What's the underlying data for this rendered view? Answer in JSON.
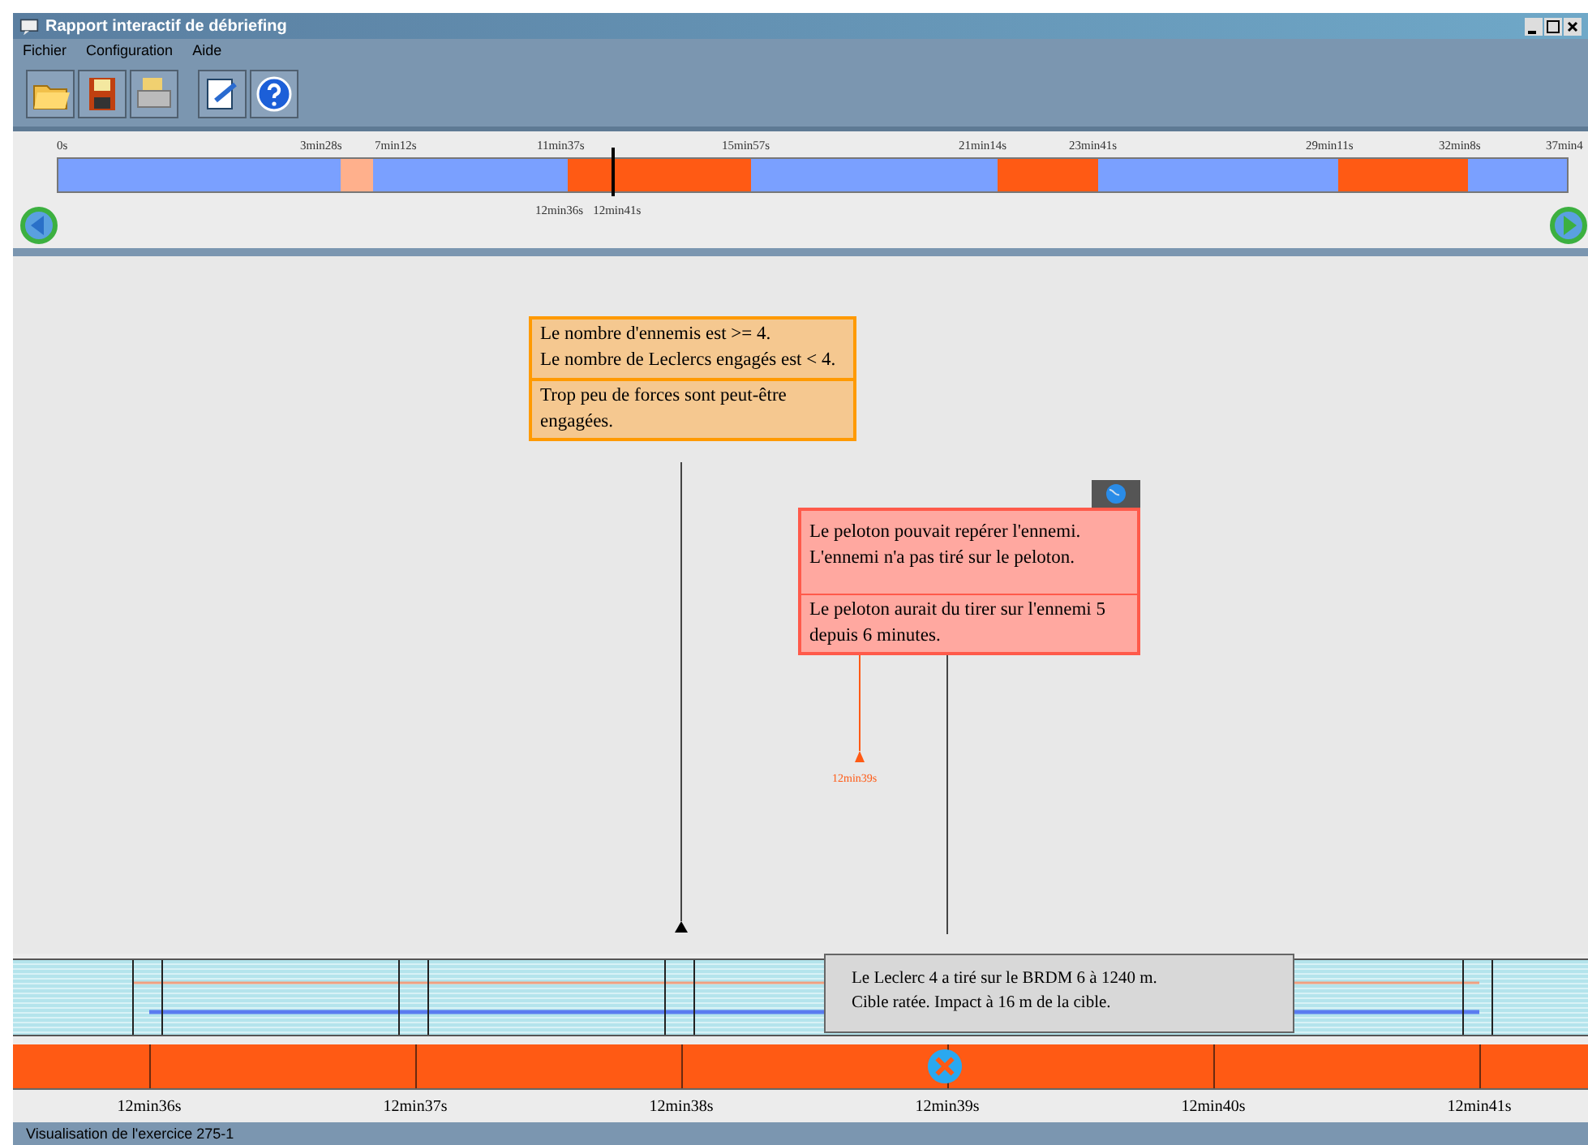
{
  "window": {
    "title": "Rapport interactif de débriefing"
  },
  "menu": [
    "Fichier",
    "Configuration",
    "Aide"
  ],
  "overview": {
    "ticks": [
      "0s",
      "3min28s",
      "7min12s",
      "11min37s",
      "15min57s",
      "21min14s",
      "23min41s",
      "29min11s",
      "32min8s",
      "37min4"
    ],
    "segments": [
      {
        "kind": "normal"
      },
      {
        "kind": "minor"
      },
      {
        "kind": "normal"
      },
      {
        "kind": "alert"
      },
      {
        "kind": "normal"
      },
      {
        "kind": "alert"
      },
      {
        "kind": "normal"
      },
      {
        "kind": "alert"
      },
      {
        "kind": "normal"
      }
    ],
    "cursor_labels": [
      "12min36s",
      "12min41s"
    ]
  },
  "cards": [
    {
      "kind": "warning",
      "condition": [
        "Le nombre d'ennemis est >= 4.",
        "Le nombre de Leclercs engagés est < 4."
      ],
      "conclusion": "Trop peu de forces sont peut-être engagées."
    },
    {
      "kind": "error",
      "condition": [
        "Le peloton pouvait repérer l'ennemi.",
        "L'ennemi n'a pas tiré sur le peloton."
      ],
      "conclusion": "Le peloton aurait du tirer sur l'ennemi 5 depuis 6 minutes."
    }
  ],
  "marker_label": "12min39s",
  "tooltip": [
    "Le Leclerc 4 a tiré sur le BRDM 6 à 1240 m.",
    "Cible ratée. Impact à 16 m de la cible."
  ],
  "time_axis": [
    "12min36s",
    "12min37s",
    "12min38s",
    "12min39s",
    "12min40s",
    "12min41s"
  ],
  "status_bar": "Visualisation de l'exercice 275-1"
}
